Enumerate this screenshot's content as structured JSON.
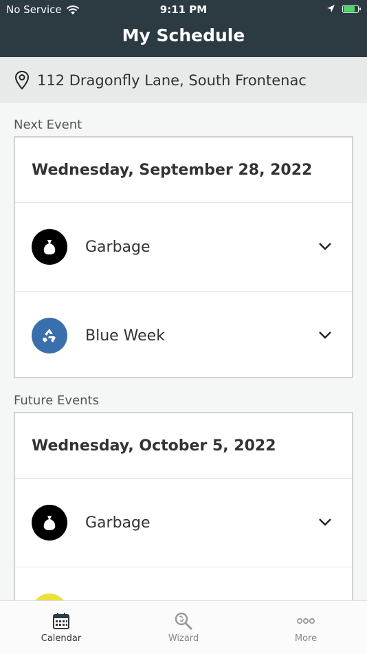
{
  "status_bar": {
    "carrier": "No Service",
    "time": "9:11 PM"
  },
  "header": {
    "title": "My Schedule"
  },
  "address": {
    "text": "112 Dragonfly Lane, South Frontenac"
  },
  "next_event": {
    "section_label": "Next Event",
    "date": "Wednesday, September 28, 2022",
    "items": [
      {
        "label": "Garbage",
        "icon": "garbage-bag-icon",
        "color": "#000000"
      },
      {
        "label": "Blue Week",
        "icon": "recycle-icon",
        "color": "#3a6fae"
      }
    ]
  },
  "future_events": {
    "section_label": "Future Events",
    "date": "Wednesday, October 5, 2022",
    "items": [
      {
        "label": "Garbage",
        "icon": "garbage-bag-icon",
        "color": "#000000"
      },
      {
        "label": "",
        "icon": "yellow-circle-icon",
        "color": "#ece03c"
      }
    ]
  },
  "tabbar": {
    "tabs": [
      {
        "label": "Calendar",
        "icon": "calendar-icon",
        "active": true
      },
      {
        "label": "Wizard",
        "icon": "wizard-search-icon",
        "active": false
      },
      {
        "label": "More",
        "icon": "more-dots-icon",
        "active": false
      }
    ]
  },
  "colors": {
    "header_bg": "#2c3a42",
    "accent_blue": "#3a6fae"
  }
}
